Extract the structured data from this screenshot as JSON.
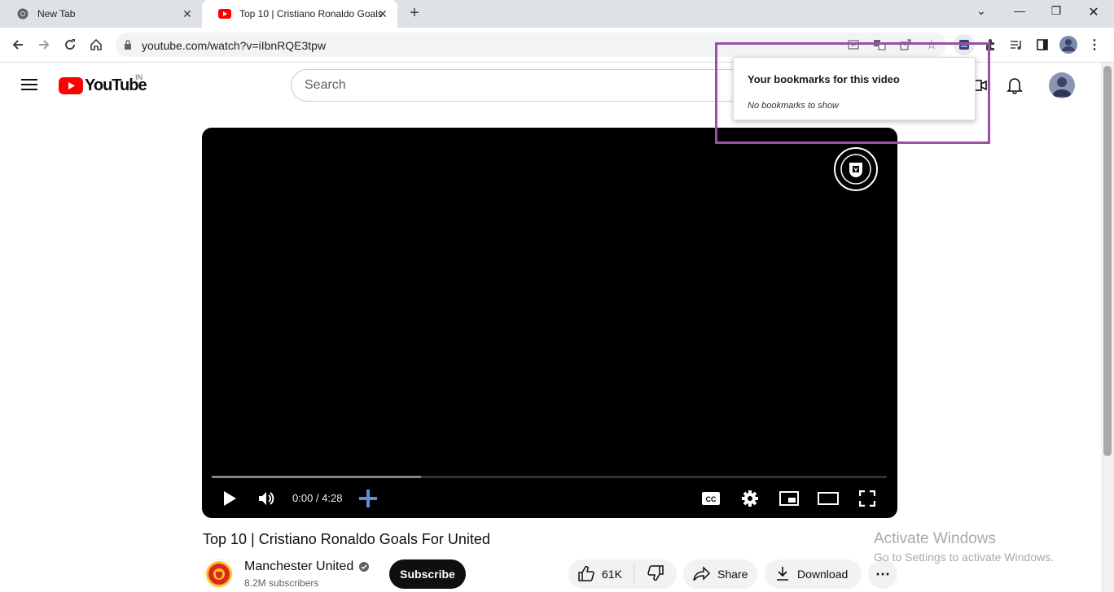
{
  "browser": {
    "tabs": [
      {
        "label": "New Tab",
        "icon": "chrome-icon"
      },
      {
        "label": "Top 10 | Cristiano Ronaldo Goals",
        "icon": "youtube-favicon"
      }
    ],
    "new_tab_symbol": "+",
    "address": {
      "url": "youtube.com/watch?v=iIbnRQE3tpw"
    }
  },
  "youtube": {
    "logo_text": "YouTube",
    "country_code": "IN",
    "search_placeholder": "Search"
  },
  "player": {
    "watermark": "MANCHESTER UNITED",
    "time_display": "0:00 / 4:28",
    "progress_buffered": 0.31,
    "progress_played": 0.0
  },
  "video": {
    "title": "Top 10 | Cristiano Ronaldo Goals For United",
    "channel_name": "Manchester United",
    "subscribers": "8.2M subscribers",
    "subscribe_label": "Subscribe",
    "likes": "61K",
    "share_label": "Share",
    "download_label": "Download"
  },
  "bookmark_popup": {
    "title": "Your bookmarks for this video",
    "empty_text": "No bookmarks to show",
    "highlight_color": "#9b4fa5"
  },
  "watermark": {
    "line1": "Activate Windows",
    "line2": "Go to Settings to activate Windows."
  },
  "colors": {
    "youtube_red": "#ff0000",
    "add_bookmark_blue": "#5b8fd9",
    "tabstrip": "#dee1e6"
  }
}
